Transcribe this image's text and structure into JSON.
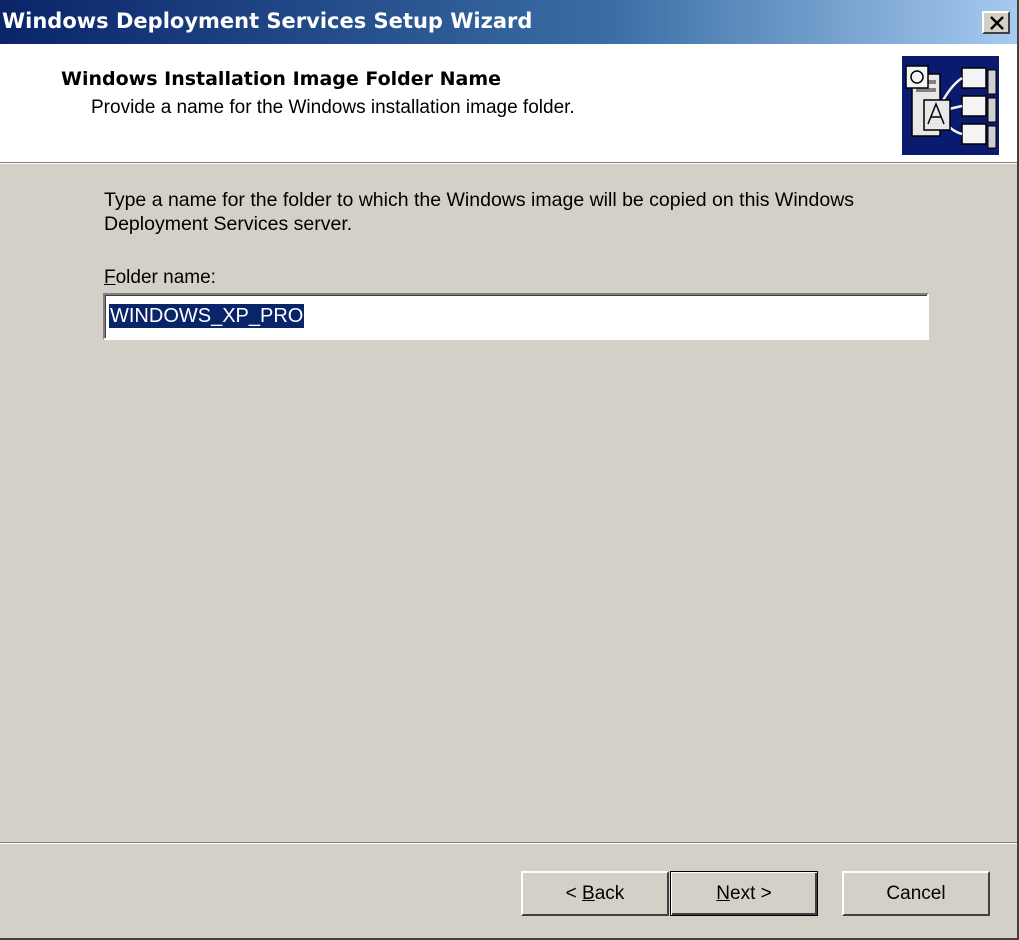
{
  "window": {
    "title": "Windows Deployment Services Setup Wizard",
    "close_icon": "close-icon"
  },
  "header": {
    "title": "Windows Installation Image Folder Name",
    "subtitle": "Provide a name for the Windows installation image folder.",
    "icon": "wizard-server-icon"
  },
  "body": {
    "instructions": "Type a name for the folder to which the Windows image will be copied on this Windows Deployment Services server.",
    "folder_label_mnemonic": "F",
    "folder_label_rest": "older name:",
    "folder_value": "WINDOWS_XP_PRO"
  },
  "buttons": {
    "back_prefix": "< ",
    "back_mnemonic": "B",
    "back_rest": "ack",
    "next_mnemonic": "N",
    "next_rest": "ext >",
    "cancel": "Cancel"
  },
  "colors": {
    "titlebar_start": "#0a246a",
    "titlebar_end": "#a6caf0",
    "dialog_face": "#d4d0c8",
    "selection": "#0a246a"
  }
}
